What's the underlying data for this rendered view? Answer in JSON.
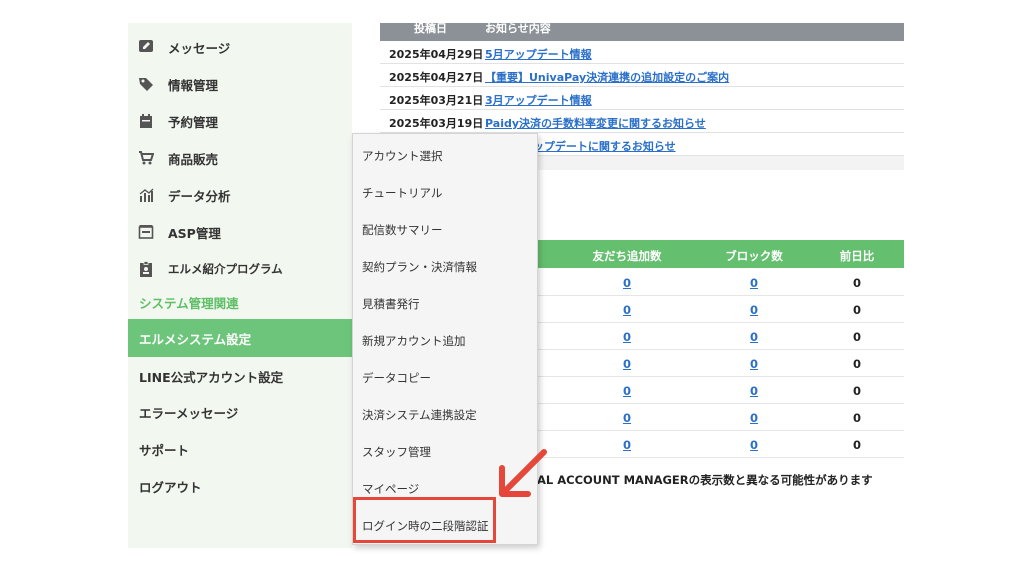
{
  "sidebar": {
    "items": [
      {
        "label": "メッセージ",
        "icon": "message-edit-icon"
      },
      {
        "label": "情報管理",
        "icon": "tag-icon"
      },
      {
        "label": "予約管理",
        "icon": "calendar-icon"
      },
      {
        "label": "商品販売",
        "icon": "cart-icon"
      },
      {
        "label": "データ分析",
        "icon": "chart-icon"
      },
      {
        "label": "ASP管理",
        "icon": "inbox-icon"
      },
      {
        "label": "エルメ紹介プログラム",
        "icon": "badge-icon"
      }
    ],
    "section_label": "システム管理関連",
    "system_items": [
      {
        "label": "エルメシステム設定",
        "active": true
      },
      {
        "label": "LINE公式アカウント設定"
      },
      {
        "label": "エラーメッセージ"
      },
      {
        "label": "サポート"
      },
      {
        "label": "ログアウト"
      }
    ]
  },
  "news": {
    "header_date": "投稿日",
    "header_content": "お知らせ内容",
    "rows": [
      {
        "date": "2025年04月29日",
        "title": "5月アップデート情報"
      },
      {
        "date": "2025年04月27日",
        "title": "【重要】UnivaPay決済連携の追加設定のご案内"
      },
      {
        "date": "2025年03月21日",
        "title": "3月アップデート情報"
      },
      {
        "date": "2025年03月19日",
        "title": "Paidy決済の手数料率変更に関するお知らせ"
      },
      {
        "date": "",
        "title": "成機能 アップデートに関するお知らせ"
      }
    ]
  },
  "stats": {
    "headers": [
      "友だち追加数",
      "ブロック数",
      "前日比"
    ],
    "rows": [
      [
        "0",
        "0",
        "0"
      ],
      [
        "0",
        "0",
        "0"
      ],
      [
        "0",
        "0",
        "0"
      ],
      [
        "0",
        "0",
        "0"
      ],
      [
        "0",
        "0",
        "0"
      ],
      [
        "0",
        "0",
        "0"
      ],
      [
        "0",
        "0",
        "0"
      ]
    ],
    "note": "AL ACCOUNT MANAGERの表示数と異なる可能性があります"
  },
  "dropdown": {
    "items": [
      "アカウント選択",
      "チュートリアル",
      "配信数サマリー",
      "契約プラン・決済情報",
      "見積書発行",
      "新規アカウント追加",
      "データコピー",
      "決済システム連携設定",
      "スタッフ管理",
      "マイページ",
      "ログイン時の二段階認証"
    ]
  },
  "colors": {
    "accent_green": "#6cc57a",
    "section_green": "#5fbf67",
    "link_blue": "#2a6fc9",
    "highlight_red": "#e5473a"
  }
}
